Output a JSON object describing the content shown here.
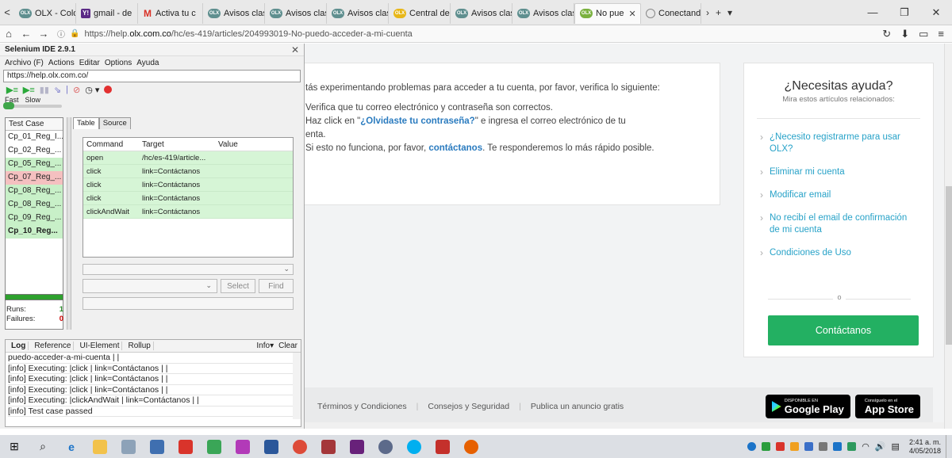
{
  "browser": {
    "tabs": [
      {
        "label": "OLX - Colo",
        "icon": "olx-icon"
      },
      {
        "label": "gmail - de",
        "icon": "yahoo-icon"
      },
      {
        "label": "Activa tu c",
        "icon": "gmail-icon"
      },
      {
        "label": "Avisos clas",
        "icon": "olx-icon"
      },
      {
        "label": "Avisos clas",
        "icon": "olx-icon"
      },
      {
        "label": "Avisos clas",
        "icon": "olx-icon"
      },
      {
        "label": "Central de",
        "icon": "olx-icon"
      },
      {
        "label": "Avisos clas",
        "icon": "olx-icon"
      },
      {
        "label": "Avisos clas",
        "icon": "olx-icon"
      },
      {
        "label": "No pue",
        "icon": "olx-icon",
        "active": true
      },
      {
        "label": "Conectand",
        "icon": "globe-icon"
      }
    ],
    "url_prefix": "https://help.",
    "url_host": "olx.com.co",
    "url_path": "/hc/es-419/articles/204993019-No-puedo-acceder-a-mi-cuenta"
  },
  "selenium": {
    "title": "Selenium IDE 2.9.1",
    "menu": [
      "Archivo (F)",
      "Actions",
      "Editar",
      "Options",
      "Ayuda"
    ],
    "base_url": "https://help.olx.com.co/",
    "speed_fast": "Fast",
    "speed_slow": "Slow",
    "testcase_header": "Test Case",
    "testcases": [
      {
        "label": "Cp_01_Reg_I...",
        "status": "none"
      },
      {
        "label": "Cp_02_Reg_...",
        "status": "none"
      },
      {
        "label": "Cp_05_Reg_...",
        "status": "pass"
      },
      {
        "label": "Cp_07_Reg_...",
        "status": "fail"
      },
      {
        "label": "Cp_08_Reg_...",
        "status": "pass"
      },
      {
        "label": "Cp_08_Reg_...",
        "status": "pass"
      },
      {
        "label": "Cp_09_Reg_...",
        "status": "pass"
      },
      {
        "label": "Cp_10_Reg...",
        "status": "pass",
        "bold": true
      }
    ],
    "runs_label": "Runs:",
    "runs_value": "1",
    "failures_label": "Failures:",
    "failures_value": "0",
    "tab_table": "Table",
    "tab_source": "Source",
    "columns": {
      "command": "Command",
      "target": "Target",
      "value": "Value"
    },
    "commands": [
      {
        "command": "open",
        "target": "/hc/es-419/article...",
        "value": ""
      },
      {
        "command": "click",
        "target": "link=Contáctanos",
        "value": ""
      },
      {
        "command": "click",
        "target": "link=Contáctanos",
        "value": ""
      },
      {
        "command": "click",
        "target": "link=Contáctanos",
        "value": ""
      },
      {
        "command": "clickAndWait",
        "target": "link=Contáctanos",
        "value": ""
      }
    ],
    "select_label": "Select",
    "find_label": "Find",
    "log_tabs": [
      "Log",
      "Reference",
      "UI-Element",
      "Rollup"
    ],
    "log_info_label": "Info▾",
    "log_clear_label": "Clear",
    "log_lines": [
      "puedo-acceder-a-mi-cuenta | |",
      "[info] Executing: |click | link=Contáctanos | |",
      "[info] Executing: |click | link=Contáctanos | |",
      "[info] Executing: |click | link=Contáctanos | |",
      "[info] Executing: |clickAndWait | link=Contáctanos | |",
      "[info] Test case passed"
    ]
  },
  "article": {
    "intro": "tás experimentando problemas para acceder a tu cuenta, por favor, verifica lo siguiente:",
    "item1": "Verifica que tu correo electrónico y contraseña son correctos.",
    "item2_pre": "Haz click en \"",
    "item2_link": "¿Olvidaste tu contraseña?",
    "item2_post": "\" e ingresa el correo electrónico de tu",
    "item2_cont": "enta.",
    "item3_pre": "Si esto no funciona, por favor, ",
    "item3_link": "contáctanos",
    "item3_post": ". Te responderemos lo más rápido posible."
  },
  "help": {
    "title": "¿Necesitas ayuda?",
    "subtitle": "Mira estos artículos relacionados:",
    "links": [
      {
        "line1": "¿Necesito registrarme para usar",
        "line2": "OLX?"
      },
      {
        "line1": "Eliminar mi cuenta",
        "line2": ""
      },
      {
        "line1": "Modificar email",
        "line2": ""
      },
      {
        "line1": "No recibí el email de confirmación",
        "line2": "de mi cuenta"
      },
      {
        "line1": "Condiciones de Uso",
        "line2": ""
      }
    ],
    "or_label": "o",
    "contact_button": "Contáctanos"
  },
  "footer": {
    "links": [
      "Términos y Condiciones",
      "Consejos y Seguridad",
      "Publica un anuncio gratis"
    ],
    "google_small": "DISPONIBLE EN",
    "google_big": "Google Play",
    "apple_small": "Consíguelo en el",
    "apple_big": "App Store"
  },
  "taskbar": {
    "time": "2:41 a. m.",
    "date": "4/05/2018"
  },
  "colors": {
    "accent_link": "#27a2c8",
    "contact_green": "#23b062",
    "pass_green": "#c8f0c8",
    "fail_red": "#f5c0c0"
  }
}
